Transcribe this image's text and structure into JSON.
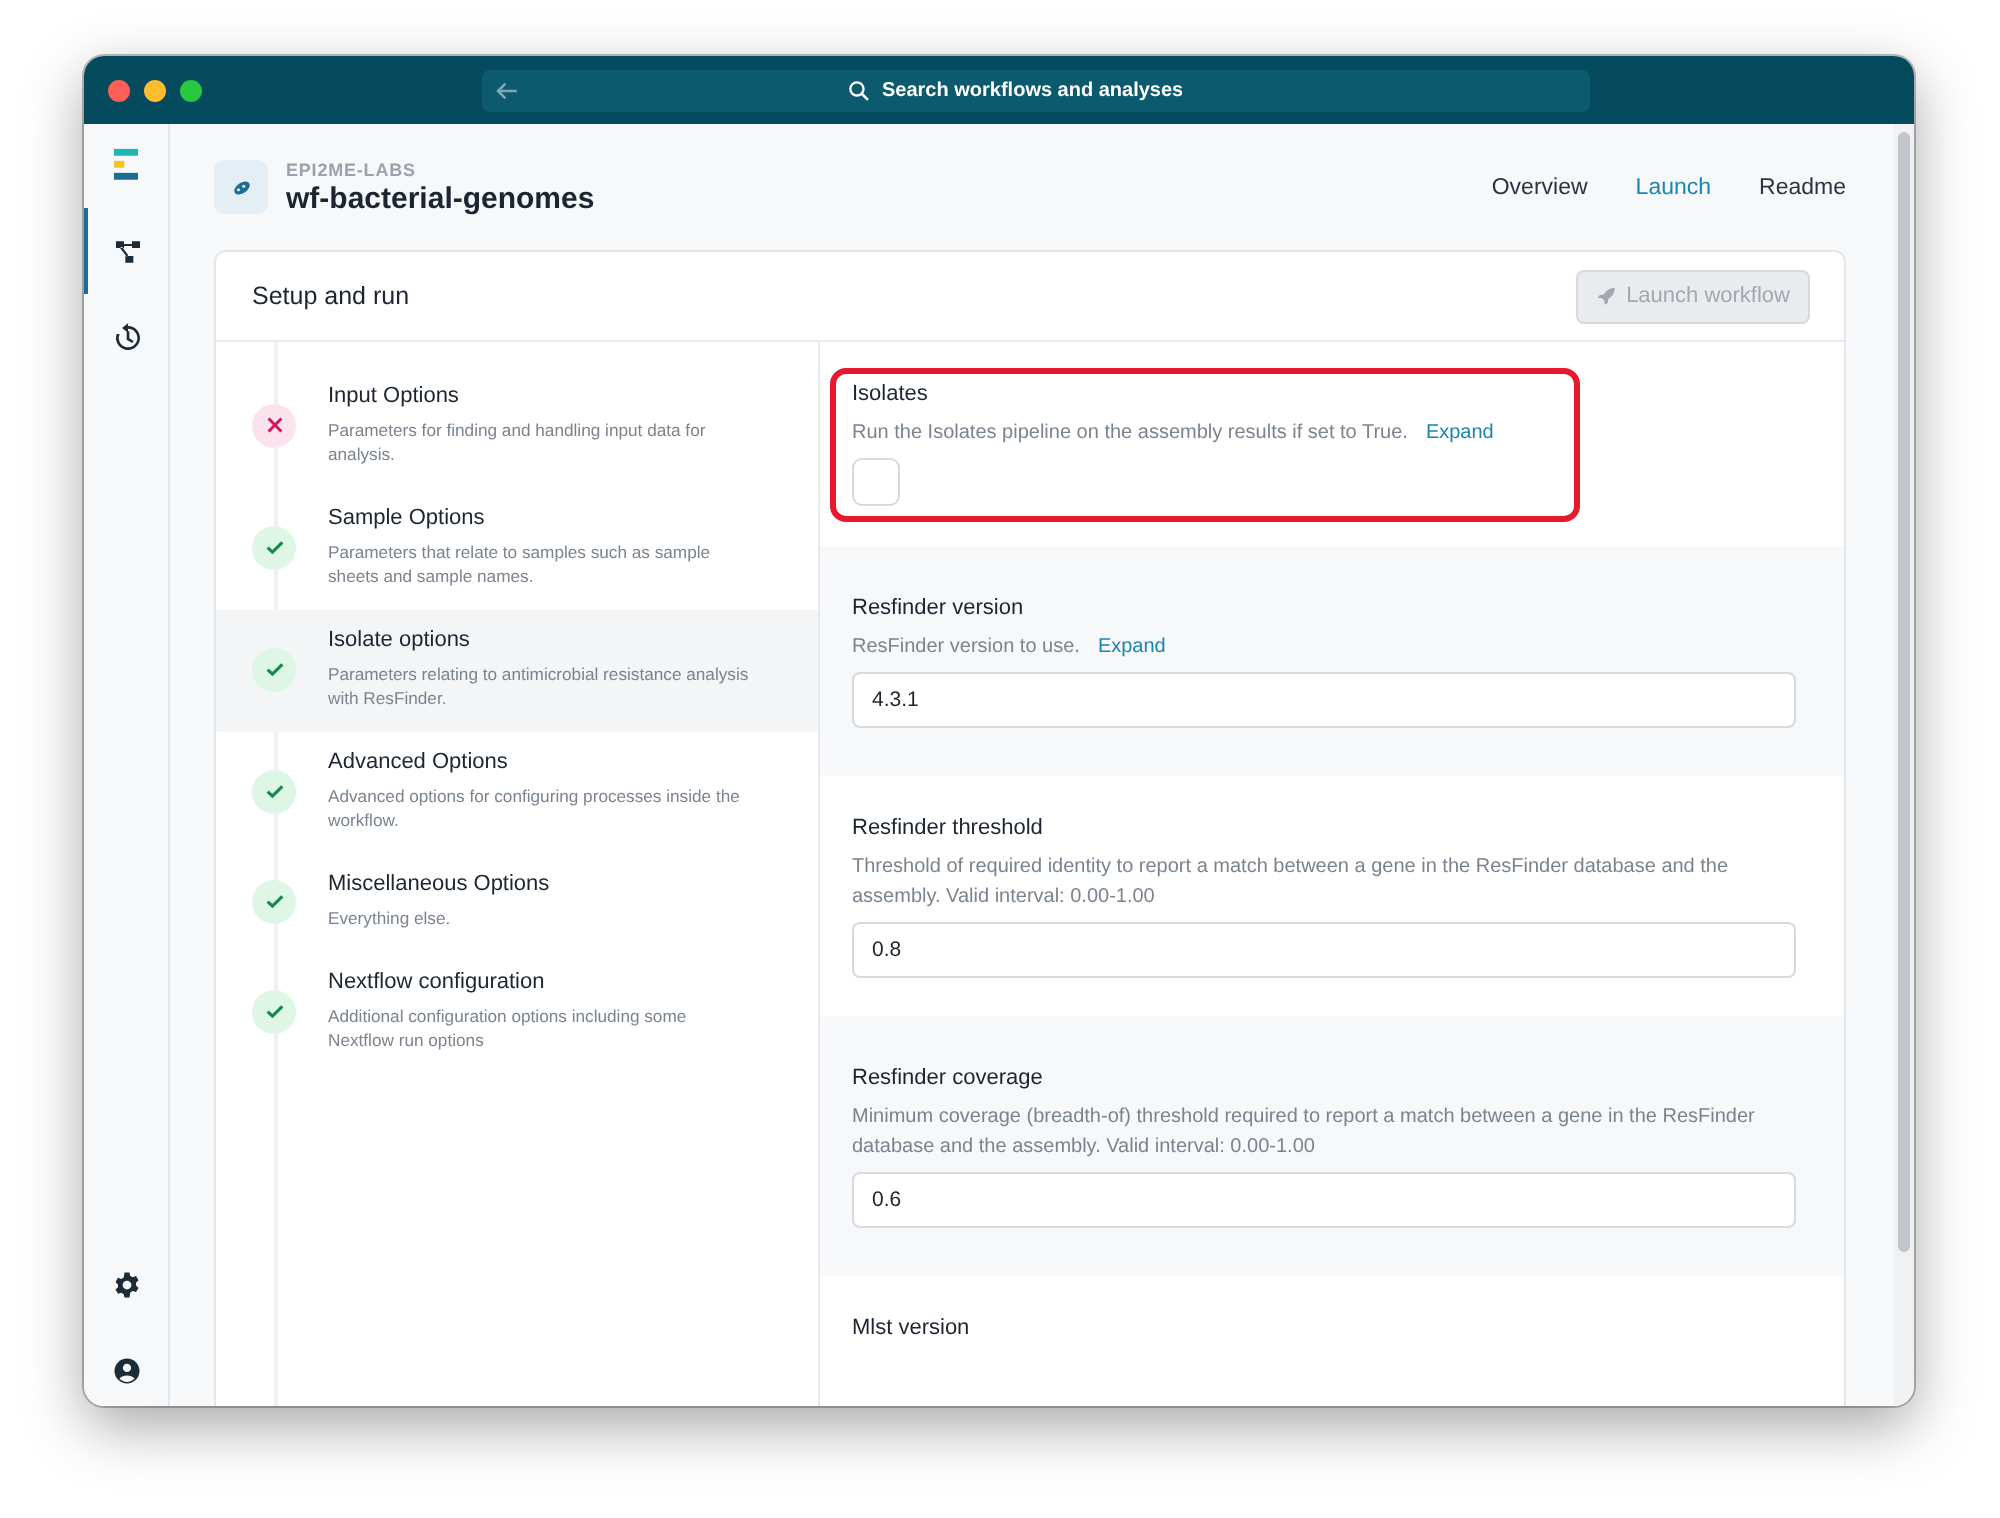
{
  "window": {
    "search": {
      "placeholder": "Search workflows and analyses"
    }
  },
  "rail": {
    "items": [
      {
        "kind": "workflows",
        "selected": true
      },
      {
        "kind": "history",
        "selected": false
      }
    ]
  },
  "header": {
    "org": "EPI2ME-LABS",
    "title": "wf-bacterial-genomes",
    "tabs": [
      {
        "label": "Overview",
        "selected": false
      },
      {
        "label": "Launch",
        "selected": true
      },
      {
        "label": "Readme",
        "selected": false
      }
    ]
  },
  "card": {
    "title": "Setup and run",
    "launch_button": {
      "label": "Launch workflow",
      "disabled": true
    },
    "steps": [
      {
        "title": "Input Options",
        "description": "Parameters for finding and handling input data for analysis.",
        "kind": "error",
        "selected": false
      },
      {
        "title": "Sample Options",
        "description": "Parameters that relate to samples such as sample sheets and sample names.",
        "kind": "done",
        "selected": false
      },
      {
        "title": "Isolate options",
        "description": "Parameters relating to antimicrobial resistance analysis with ResFinder.",
        "kind": "done",
        "selected": true
      },
      {
        "title": "Advanced Options",
        "description": "Advanced options for configuring processes inside the workflow.",
        "kind": "done",
        "selected": false
      },
      {
        "title": "Miscellaneous Options",
        "description": "Everything else.",
        "kind": "done",
        "selected": false
      },
      {
        "title": "Nextflow configuration",
        "description": "Additional configuration options including some Nextflow run options",
        "kind": "done",
        "selected": false
      }
    ],
    "params": [
      {
        "kind": "checkbox",
        "label": "Isolates",
        "description": "Run the Isolates pipeline on the assembly results if set to True.",
        "expand": "Expand",
        "checked": false,
        "highlighted": true
      },
      {
        "kind": "text",
        "label": "Resfinder version",
        "description": "ResFinder version to use.",
        "expand": "Expand",
        "value": "4.3.1",
        "highlighted": false
      },
      {
        "kind": "text",
        "label": "Resfinder threshold",
        "description": "Threshold of required identity to report a match between a gene in the ResFinder database and the assembly. Valid interval: 0.00-1.00",
        "value": "0.8",
        "highlighted": false
      },
      {
        "kind": "text",
        "label": "Resfinder coverage",
        "description": "Minimum coverage (breadth-of) threshold required to report a match between a gene in the ResFinder database and the assembly. Valid interval: 0.00-1.00",
        "value": "0.6",
        "highlighted": false
      },
      {
        "kind": "heading",
        "label": "Mlst version",
        "highlighted": false
      }
    ]
  }
}
